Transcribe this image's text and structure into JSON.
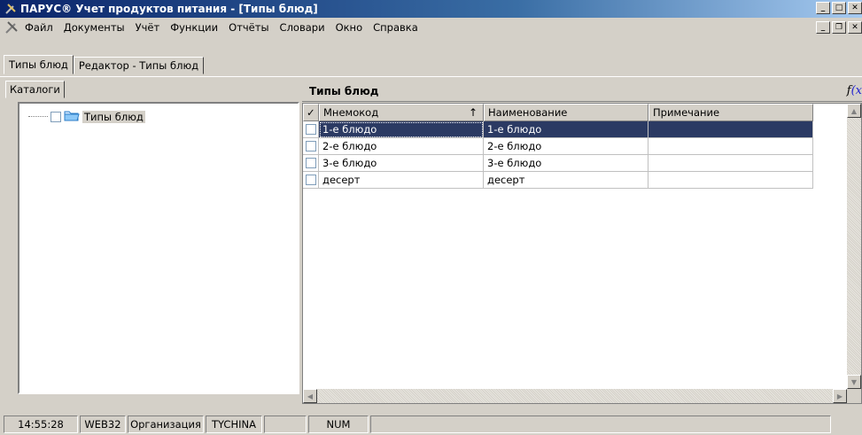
{
  "window": {
    "title": "ПАРУС® Учет продуктов питания - [Типы блюд]",
    "app_icon": "tools-icon"
  },
  "menu": {
    "items": [
      "Файл",
      "Документы",
      "Учёт",
      "Функции",
      "Отчёты",
      "Словари",
      "Окно",
      "Справка"
    ]
  },
  "doc_tabs": [
    "Типы блюд",
    "Редактор - Типы блюд"
  ],
  "left": {
    "tab": "Каталоги",
    "tree": {
      "label": "Типы блюд",
      "icon": "folder-icon"
    }
  },
  "right": {
    "title": "Типы блюд",
    "fx": {
      "f": "f",
      "x": "(x"
    },
    "columns": [
      "Мнемокод",
      "Наименование",
      "Примечание"
    ],
    "sort_indicator": "↑",
    "check_header": "✓",
    "rows": [
      {
        "code": "1-е блюдо",
        "name": "1-е блюдо",
        "note": ""
      },
      {
        "code": "2-е блюдо",
        "name": "2-е блюдо",
        "note": ""
      },
      {
        "code": "3-е блюдо",
        "name": "3-е блюдо",
        "note": ""
      },
      {
        "code": "десерт",
        "name": "десерт",
        "note": ""
      }
    ]
  },
  "status": [
    "14:55:28",
    "WEB32",
    "Организация",
    "TYCHINA",
    "",
    "NUM",
    ""
  ],
  "colors": {
    "selection": "#2b3a63",
    "titlebar": "#0a246a"
  }
}
